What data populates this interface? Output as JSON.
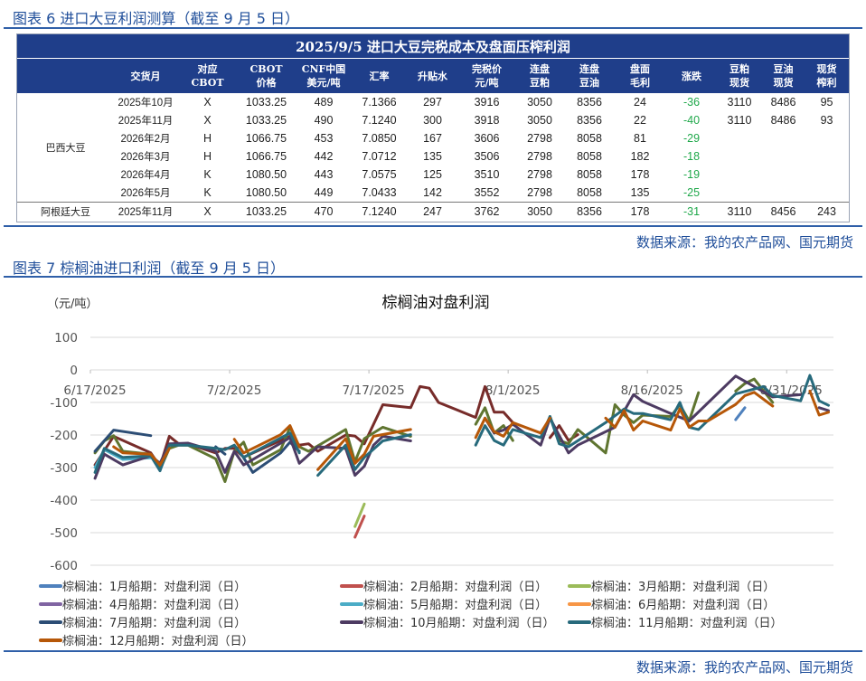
{
  "section1": {
    "title": "图表 6 进口大豆利润测算（截至 9 月 5 日）",
    "source": "数据来源：我的农产品网、国元期货"
  },
  "table": {
    "title": "2025/9/5 进口大豆完税成本及盘面压榨利润",
    "headers": [
      [
        "",
        ""
      ],
      [
        "交货月",
        ""
      ],
      [
        "对应",
        "CBOT"
      ],
      [
        "CBOT",
        "价格"
      ],
      [
        "CNF中国",
        "美元/吨"
      ],
      [
        "汇率",
        ""
      ],
      [
        "升贴水",
        ""
      ],
      [
        "完税价",
        "元/吨"
      ],
      [
        "连盘",
        "豆粕"
      ],
      [
        "连盘",
        "豆油"
      ],
      [
        "盘面",
        "毛利"
      ],
      [
        "涨跌",
        ""
      ],
      [
        "豆粕",
        "现货"
      ],
      [
        "豆油",
        "现货"
      ],
      [
        "现货",
        "榨利"
      ]
    ],
    "groups": [
      {
        "name": "巴西大豆",
        "rows": [
          [
            "2025年10月",
            "X",
            "1033.25",
            "489",
            "7.1366",
            "297",
            "3916",
            "3050",
            "8356",
            "24",
            "-36",
            "3110",
            "8486",
            "95"
          ],
          [
            "2025年11月",
            "X",
            "1033.25",
            "490",
            "7.1240",
            "300",
            "3918",
            "3050",
            "8356",
            "22",
            "-40",
            "3110",
            "8486",
            "93"
          ],
          [
            "2026年2月",
            "H",
            "1066.75",
            "453",
            "7.0850",
            "167",
            "3606",
            "2798",
            "8058",
            "81",
            "-29",
            "",
            "",
            ""
          ],
          [
            "2026年3月",
            "H",
            "1066.75",
            "442",
            "7.0712",
            "135",
            "3506",
            "2798",
            "8058",
            "182",
            "-18",
            "",
            "",
            ""
          ],
          [
            "2026年4月",
            "K",
            "1080.50",
            "443",
            "7.0575",
            "125",
            "3510",
            "2798",
            "8058",
            "178",
            "-19",
            "",
            "",
            ""
          ],
          [
            "2026年5月",
            "K",
            "1080.50",
            "449",
            "7.0433",
            "142",
            "3552",
            "2798",
            "8058",
            "135",
            "-25",
            "",
            "",
            ""
          ]
        ]
      },
      {
        "name": "阿根廷大豆",
        "rows": [
          [
            "2025年11月",
            "X",
            "1033.25",
            "470",
            "7.1240",
            "247",
            "3762",
            "3050",
            "8356",
            "178",
            "-31",
            "3110",
            "8456",
            "243"
          ]
        ]
      }
    ]
  },
  "section2": {
    "title": "图表 7 棕榈油进口利润（截至 9 月 5 日）",
    "source": "数据来源：我的农产品网、国元期货"
  },
  "chart_data": {
    "type": "line",
    "title": "棕榈油对盘利润",
    "ylabel": "（元/吨）",
    "xlabel": "",
    "ylim": [
      -600,
      100
    ],
    "yticks": [
      100,
      0,
      -100,
      -200,
      -300,
      -400,
      -500,
      -600
    ],
    "x_origin": "2025-06-17",
    "x_unit": "days since origin",
    "xlim": [
      0,
      80
    ],
    "xticks": [
      {
        "x": 0,
        "label": "6/17/2025"
      },
      {
        "x": 15,
        "label": "7/2/2025"
      },
      {
        "x": 30,
        "label": "7/17/2025"
      },
      {
        "x": 45,
        "label": "8/1/2025"
      },
      {
        "x": 60,
        "label": "8/16/2025"
      },
      {
        "x": 75,
        "label": "8/31/2025"
      }
    ],
    "grid": true,
    "legend_position": "bottom",
    "series": [
      {
        "name": "",
        "legend": false,
        "color": "#772C2A",
        "points": [
          [
            0,
            -292
          ],
          [
            2,
            -204
          ],
          [
            6,
            -255
          ],
          [
            7,
            -296
          ],
          [
            8,
            -204
          ],
          [
            9,
            -227
          ],
          [
            10,
            -227
          ],
          [
            13,
            -255
          ],
          [
            14,
            -241
          ],
          [
            15,
            -241
          ],
          [
            16,
            -268
          ],
          [
            21,
            -204
          ],
          [
            22,
            -231
          ],
          [
            23,
            -227
          ],
          [
            24,
            -250
          ],
          [
            27,
            -200
          ],
          [
            28,
            -203
          ],
          [
            29,
            -227
          ],
          [
            31,
            -107
          ],
          [
            34,
            -116
          ],
          [
            35,
            -51
          ],
          [
            36,
            -56
          ],
          [
            37,
            -100
          ],
          [
            41,
            -146
          ],
          [
            42,
            -51
          ],
          [
            43,
            -130
          ],
          [
            44,
            -130
          ],
          [
            45,
            -162
          ],
          [
            46,
            null
          ],
          [
            49,
            -208
          ],
          [
            50,
            -171
          ],
          [
            51,
            -217
          ],
          [
            52,
            -199
          ]
        ]
      },
      {
        "name": "",
        "legend": false,
        "color": "#5F7530",
        "points": [
          [
            0,
            -255
          ],
          [
            1,
            -218
          ],
          [
            2,
            -202
          ],
          [
            3,
            -250
          ],
          [
            6,
            -259
          ],
          [
            7,
            -306
          ],
          [
            8,
            -241
          ],
          [
            9,
            -231
          ],
          [
            10,
            -231
          ],
          [
            13,
            -273
          ],
          [
            14,
            -343
          ],
          [
            15,
            -250
          ],
          [
            16,
            -222
          ],
          [
            17,
            -292
          ],
          [
            20,
            -245
          ],
          [
            21,
            -176
          ],
          [
            22,
            -236
          ],
          [
            23,
            -250
          ],
          [
            27,
            -183
          ],
          [
            28,
            -282
          ],
          [
            29,
            -211
          ],
          [
            31,
            -176
          ],
          [
            34,
            -204
          ],
          [
            35,
            null
          ],
          [
            41,
            -167
          ],
          [
            42,
            -116
          ],
          [
            43,
            -194
          ],
          [
            44,
            -171
          ],
          [
            45,
            -217
          ],
          [
            46,
            null
          ],
          [
            49,
            -143
          ],
          [
            50,
            -217
          ],
          [
            51,
            -227
          ],
          [
            52,
            -183
          ],
          [
            55,
            -255
          ],
          [
            56,
            -107
          ],
          [
            57,
            -139
          ],
          [
            58,
            -162
          ],
          [
            59,
            -139
          ],
          [
            62,
            -143
          ],
          [
            63,
            -107
          ],
          [
            64,
            -157
          ],
          [
            65,
            -70
          ],
          [
            66,
            null
          ],
          [
            69,
            -65
          ],
          [
            70,
            -42
          ],
          [
            71,
            -28
          ],
          [
            73,
            -100
          ]
        ]
      },
      {
        "name": "棕榈油：1月船期：对盘利润（日）",
        "legend": true,
        "color": "#4F81BD",
        "points": [
          [
            69,
            -153
          ],
          [
            70,
            -116
          ]
        ]
      },
      {
        "name": "棕榈油：2月船期：对盘利润（日）",
        "legend": true,
        "color": "#C0504D",
        "points": [
          [
            28,
            -514
          ],
          [
            29,
            -449
          ]
        ]
      },
      {
        "name": "棕榈油：3月船期：对盘利润（日）",
        "legend": true,
        "color": "#9BBB59",
        "points": [
          [
            28,
            -481
          ],
          [
            29,
            -412
          ]
        ]
      },
      {
        "name": "棕榈油：4月船期：对盘利润（日）",
        "legend": true,
        "color": "#8064A2",
        "points": []
      },
      {
        "name": "棕榈油：5月船期：对盘利润（日）",
        "legend": true,
        "color": "#4BACC6",
        "points": [
          [
            0,
            -300
          ],
          [
            1,
            -245
          ],
          [
            3,
            -275
          ],
          [
            6,
            -270
          ]
        ]
      },
      {
        "name": "棕榈油：6月船期：对盘利润（日）",
        "legend": true,
        "color": "#F79646",
        "points": []
      },
      {
        "name": "棕榈油：7月船期：对盘利润（日）",
        "legend": true,
        "color": "#2C4D75",
        "points": [
          [
            0,
            -250
          ],
          [
            2,
            -185
          ],
          [
            6,
            -202
          ],
          [
            7,
            null
          ],
          [
            13,
            -236
          ],
          [
            14,
            -259
          ],
          [
            15,
            null
          ],
          [
            16,
            -270
          ],
          [
            17,
            -315
          ],
          [
            20,
            -255
          ],
          [
            21,
            -222
          ],
          [
            22,
            -250
          ]
        ]
      },
      {
        "name": "棕榈油：10月船期：对盘利润（日）",
        "legend": true,
        "color": "#4D3B62",
        "points": [
          [
            0,
            -333
          ],
          [
            1,
            -259
          ],
          [
            3,
            -292
          ],
          [
            6,
            -264
          ],
          [
            7,
            -287
          ],
          [
            8,
            -227
          ],
          [
            10,
            -225
          ],
          [
            13,
            -250
          ],
          [
            14,
            -315
          ],
          [
            15,
            -250
          ],
          [
            16,
            -292
          ],
          [
            21,
            -208
          ],
          [
            22,
            -287
          ],
          [
            24,
            -236
          ],
          [
            27,
            -241
          ],
          [
            28,
            -324
          ],
          [
            29,
            -296
          ],
          [
            30,
            -231
          ],
          [
            31,
            -204
          ],
          [
            34,
            -218
          ],
          [
            35,
            null
          ],
          [
            42,
            -148
          ],
          [
            43,
            -194
          ],
          [
            44,
            -185
          ],
          [
            45,
            -167
          ],
          [
            48,
            -231
          ],
          [
            49,
            -148
          ],
          [
            51,
            -255
          ],
          [
            52,
            -231
          ],
          [
            56,
            -176
          ],
          [
            58,
            -76
          ],
          [
            59,
            -97
          ],
          [
            62,
            -134
          ],
          [
            64,
            -157
          ],
          [
            69,
            -19
          ],
          [
            73,
            -83
          ],
          [
            76,
            -76
          ],
          [
            77,
            null
          ],
          [
            78,
            -116
          ],
          [
            79,
            -125
          ]
        ]
      },
      {
        "name": "棕榈油：11月船期：对盘利润（日）",
        "legend": true,
        "color": "#276A7C",
        "points": [
          [
            0,
            -315
          ],
          [
            1,
            -241
          ],
          [
            3,
            -269
          ],
          [
            6,
            -264
          ],
          [
            7,
            -310
          ],
          [
            8,
            -231
          ],
          [
            10,
            -231
          ],
          [
            13,
            -241
          ],
          [
            14,
            -245
          ],
          [
            15,
            -231
          ],
          [
            16,
            -269
          ],
          [
            21,
            -194
          ],
          [
            22,
            -255
          ],
          [
            23,
            null
          ],
          [
            24,
            -324
          ],
          [
            27,
            -231
          ],
          [
            28,
            -306
          ],
          [
            29,
            -269
          ],
          [
            31,
            -218
          ],
          [
            34,
            -199
          ],
          [
            35,
            null
          ],
          [
            41,
            -231
          ],
          [
            42,
            -171
          ],
          [
            43,
            -217
          ],
          [
            44,
            -231
          ],
          [
            45,
            -183
          ],
          [
            48,
            -208
          ],
          [
            49,
            -143
          ],
          [
            50,
            -227
          ],
          [
            51,
            -236
          ],
          [
            55,
            -162
          ],
          [
            57,
            -120
          ],
          [
            58,
            -134
          ],
          [
            59,
            -134
          ],
          [
            62,
            -153
          ],
          [
            63,
            -100
          ],
          [
            64,
            -176
          ],
          [
            65,
            -183
          ],
          [
            69,
            -74
          ],
          [
            72,
            -51
          ],
          [
            73,
            -79
          ],
          [
            76,
            -95
          ],
          [
            77,
            -17
          ],
          [
            78,
            -95
          ],
          [
            79,
            -109
          ]
        ]
      },
      {
        "name": "棕榈油：12月船期：对盘利润（日）",
        "legend": true,
        "color": "#B65708",
        "points": [
          [
            2,
            -236
          ],
          [
            3,
            -255
          ],
          [
            6,
            -259
          ],
          [
            7,
            -292
          ],
          [
            8,
            -241
          ],
          [
            9,
            null
          ],
          [
            15,
            -213
          ],
          [
            16,
            -255
          ],
          [
            20,
            -199
          ],
          [
            21,
            -171
          ],
          [
            22,
            -236
          ],
          [
            23,
            null
          ],
          [
            24,
            -306
          ],
          [
            27,
            -211
          ],
          [
            28,
            -287
          ],
          [
            29,
            -259
          ],
          [
            30,
            -204
          ],
          [
            34,
            -183
          ],
          [
            35,
            null
          ],
          [
            41,
            -208
          ],
          [
            42,
            -148
          ],
          [
            43,
            -190
          ],
          [
            44,
            -204
          ],
          [
            45,
            -162
          ],
          [
            48,
            -194
          ],
          [
            49,
            -148
          ],
          [
            50,
            null
          ],
          [
            55,
            -148
          ],
          [
            56,
            -176
          ],
          [
            57,
            -125
          ],
          [
            58,
            -185
          ],
          [
            59,
            -157
          ],
          [
            62,
            -185
          ],
          [
            63,
            -120
          ],
          [
            64,
            -176
          ],
          [
            65,
            -157
          ],
          [
            66,
            -157
          ],
          [
            69,
            -106
          ],
          [
            70,
            -79
          ],
          [
            71,
            -69
          ],
          [
            73,
            -111
          ],
          [
            74,
            null
          ],
          [
            77,
            -65
          ],
          [
            78,
            -139
          ],
          [
            79,
            -130
          ]
        ]
      }
    ]
  }
}
